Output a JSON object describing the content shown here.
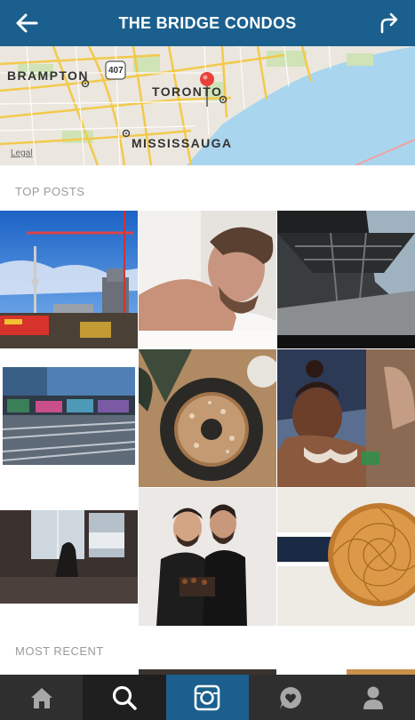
{
  "header": {
    "title": "THE BRIDGE CONDOS",
    "back_icon": "back-arrow-icon",
    "share_icon": "share-arrow-icon"
  },
  "map": {
    "labels": {
      "brampton": "BRAMPTON",
      "toronto": "TORONTO",
      "mississauga": "MISSISSAUGA",
      "highway": "407"
    },
    "legal": "Legal",
    "pin_icon": "map-pin-icon"
  },
  "sections": {
    "top_posts": "TOP POSTS",
    "most_recent": "MOST RECENT"
  },
  "tabs": [
    {
      "name": "home",
      "icon": "home-icon"
    },
    {
      "name": "explore",
      "icon": "search-icon"
    },
    {
      "name": "camera",
      "icon": "camera-icon"
    },
    {
      "name": "activity",
      "icon": "heart-bubble-icon"
    },
    {
      "name": "profile",
      "icon": "profile-icon"
    }
  ],
  "colors": {
    "header": "#1b5f8e",
    "tabbar": "#2f2f2f",
    "active_tab": "#1b5f8e",
    "pin": "#e8413a"
  }
}
